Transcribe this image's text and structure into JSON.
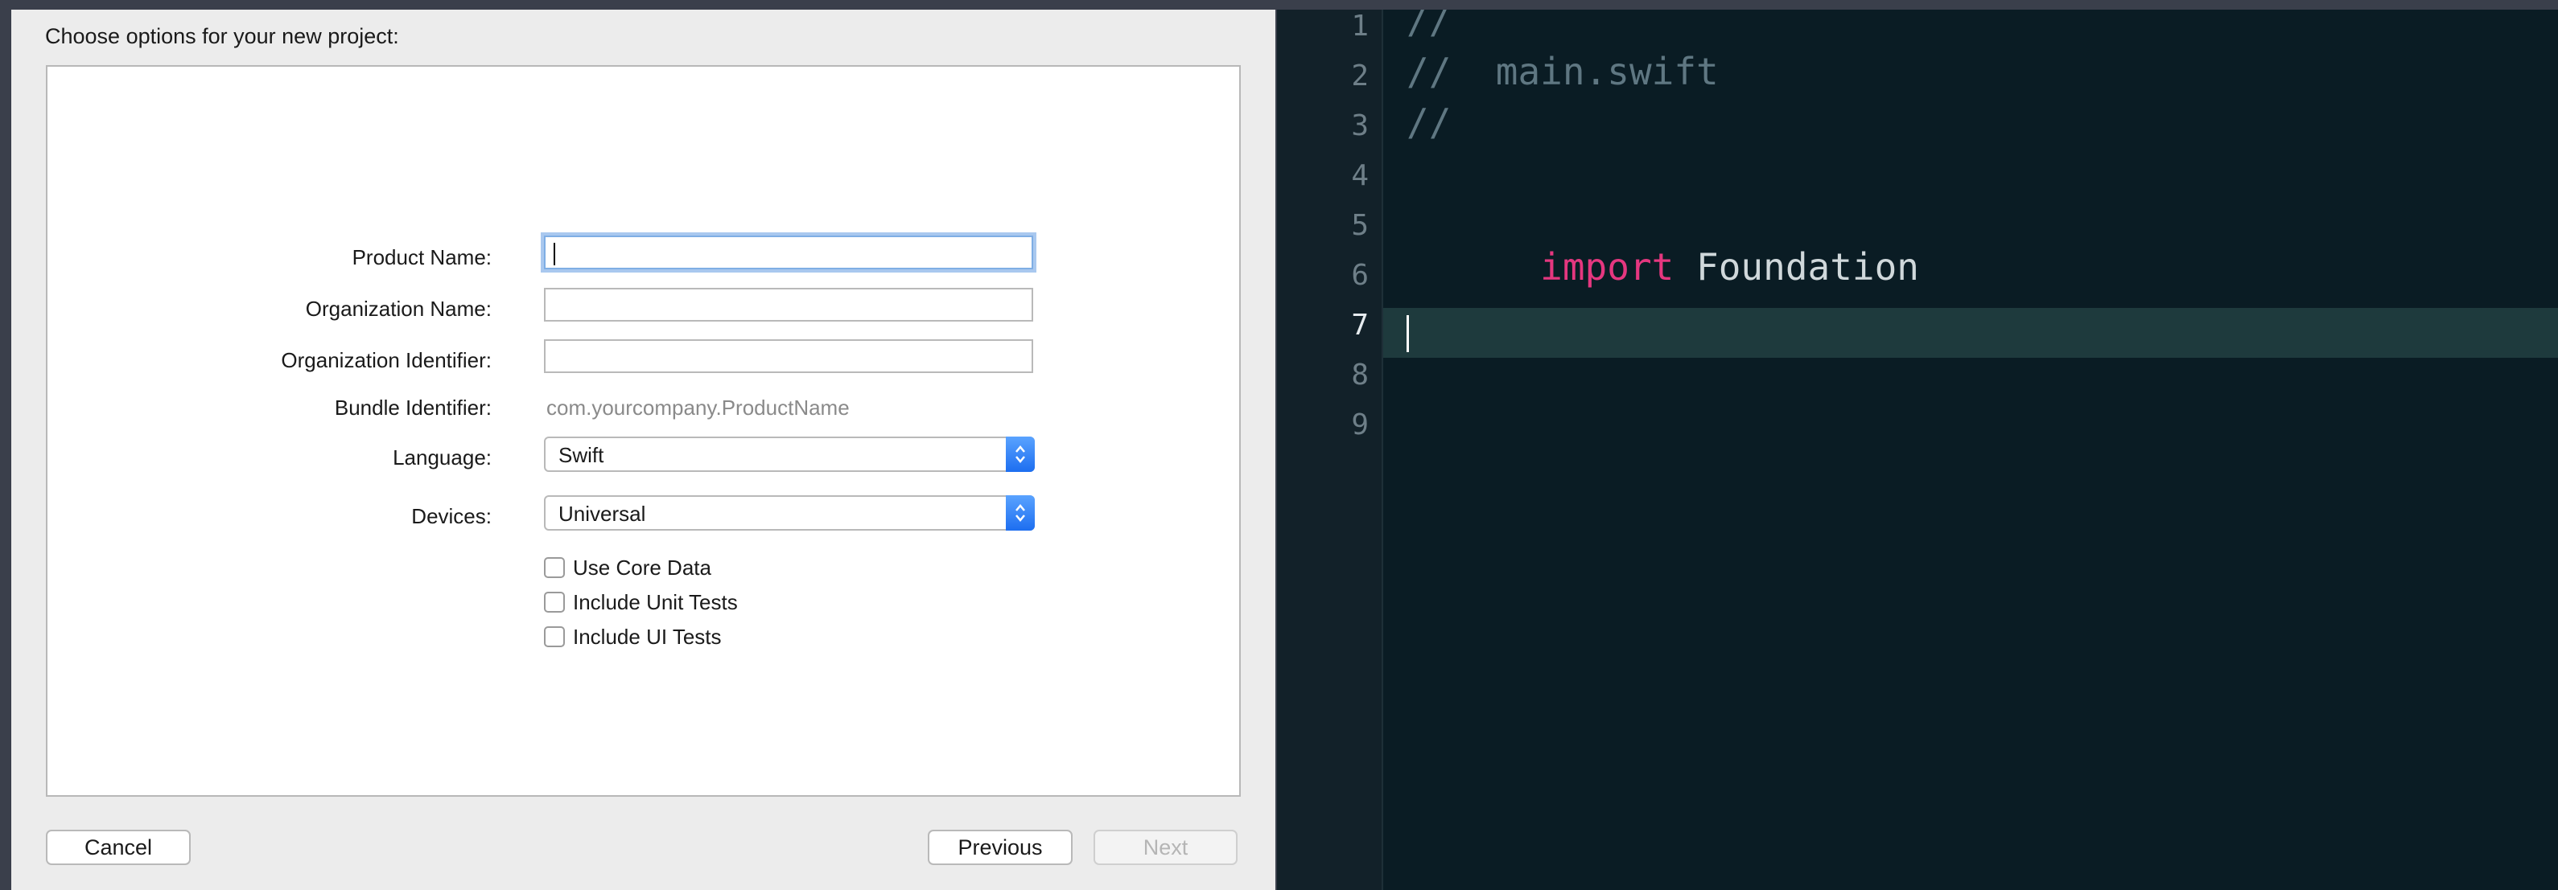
{
  "dialog": {
    "heading": "Choose options for your new project:",
    "fields": {
      "product_name_label": "Product Name:",
      "product_name_value": "",
      "organization_name_label": "Organization Name:",
      "organization_name_value": "",
      "organization_identifier_label": "Organization Identifier:",
      "organization_identifier_value": "",
      "bundle_identifier_label": "Bundle Identifier:",
      "bundle_identifier_value": "com.yourcompany.ProductName",
      "language_label": "Language:",
      "language_value": "Swift",
      "devices_label": "Devices:",
      "devices_value": "Universal"
    },
    "checkboxes": [
      {
        "label": "Use Core Data",
        "checked": false
      },
      {
        "label": "Include Unit Tests",
        "checked": false
      },
      {
        "label": "Include UI Tests",
        "checked": false
      }
    ],
    "buttons": {
      "cancel": "Cancel",
      "previous": "Previous",
      "next": "Next",
      "next_enabled": false
    }
  },
  "editor": {
    "line_numbers": [
      "1",
      "2",
      "3",
      "4",
      "5",
      "6",
      "7",
      "8",
      "9"
    ],
    "current_line": "7",
    "lines": {
      "l1": "//",
      "l2": "//  main.swift",
      "l3": "//",
      "l5_keyword": "import",
      "l5_module": " Foundation"
    },
    "colors": {
      "background": "#0a1c24",
      "keyword": "#e5377f",
      "comment": "#5f7782",
      "current_line": "#1e3a3d"
    }
  }
}
